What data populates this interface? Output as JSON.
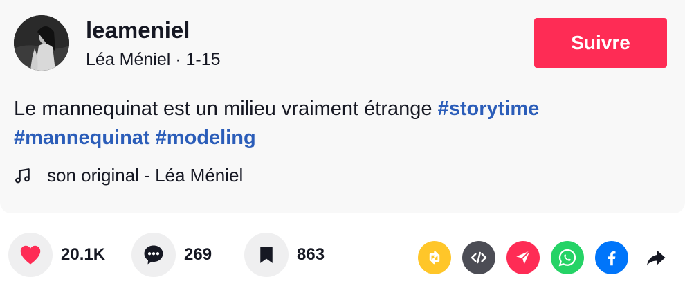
{
  "author": {
    "username": "leameniel",
    "display_name": "Léa Méniel",
    "separator": " · ",
    "date": "1-15"
  },
  "follow_label": "Suivre",
  "caption": {
    "text": "Le mannequinat est un milieu vraiment étrange",
    "hashtags": [
      "#storytime",
      "#mannequinat",
      "#modeling"
    ]
  },
  "music": {
    "icon": "music-note-icon",
    "label": "son original - Léa Méniel"
  },
  "stats": {
    "likes": "20.1K",
    "comments": "269",
    "saves": "863"
  },
  "share_icons": [
    "repost-icon",
    "embed-icon",
    "send-icon",
    "whatsapp-icon",
    "facebook-icon",
    "share-arrow-icon"
  ],
  "colors": {
    "accent": "#fe2c55",
    "hashtag": "#2b5db9",
    "like": "#fe2c55",
    "repost": "#ffc629",
    "embed": "#4c4d55",
    "send": "#fe2c55",
    "whatsapp": "#25d366",
    "facebook": "#0075fa"
  }
}
